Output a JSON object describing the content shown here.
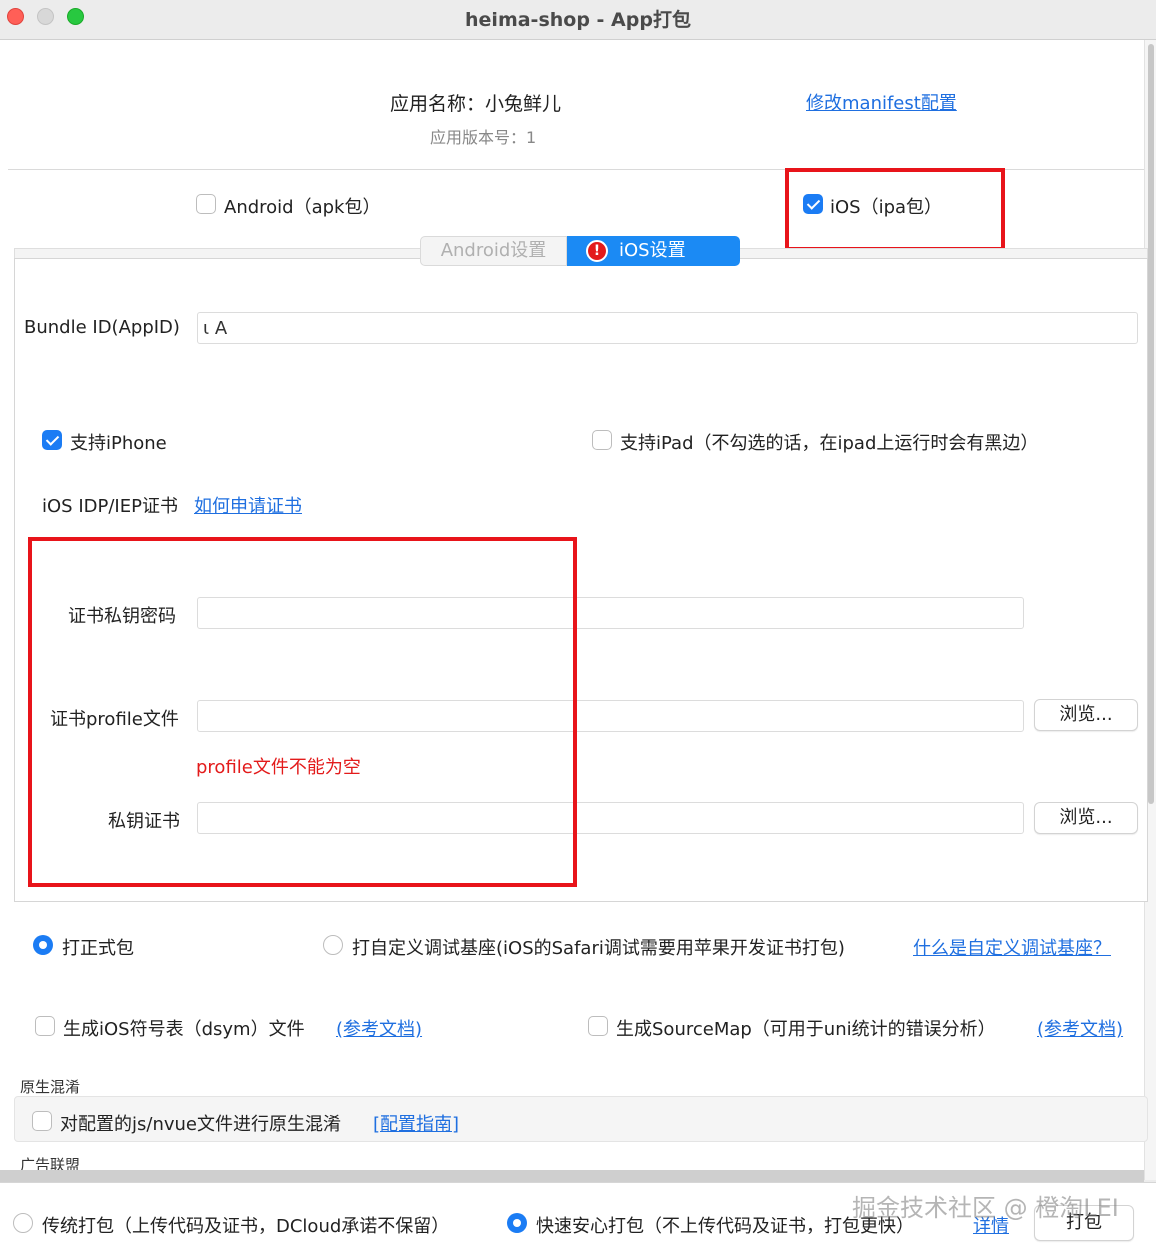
{
  "window": {
    "title": "heima-shop - App打包"
  },
  "header": {
    "app_name": "应用名称：小兔鲜儿",
    "app_version": "应用版本号：1",
    "manifest_link": "修改manifest配置"
  },
  "platforms": {
    "android": {
      "label": "Android（apk包）",
      "checked": false
    },
    "ios": {
      "label": "iOS（ipa包）",
      "checked": true
    }
  },
  "tabs": [
    {
      "label": "Android设置",
      "active": false
    },
    {
      "label": "iOS设置",
      "active": true,
      "warning": "!"
    }
  ],
  "ios_settings": {
    "bundle_id_label": "Bundle ID(AppID)",
    "bundle_id_value": "ι                    Α",
    "support_iphone": {
      "label": "支持iPhone",
      "checked": true
    },
    "support_ipad": {
      "label": "支持iPad（不勾选的话，在ipad上运行时会有黑边）",
      "checked": false
    },
    "cert_label": "iOS IDP/IEP证书",
    "cert_help_link": "如何申请证书",
    "private_key_password_label": "证书私钥密码",
    "profile_label": "证书profile文件",
    "profile_error": "profile文件不能为空",
    "private_cert_label": "私钥证书",
    "browse_label": "浏览..."
  },
  "package_type": {
    "formal": {
      "label": "打正式包",
      "checked": true
    },
    "custom_base": {
      "label": "打自定义调试基座(iOS的Safari调试需要用苹果开发证书打包)",
      "checked": false
    },
    "custom_base_help": "什么是自定义调试基座？"
  },
  "options": {
    "dsym": {
      "label": "生成iOS符号表（dsym）文件",
      "checked": false,
      "link": "(参考文档)"
    },
    "sourcemap": {
      "label": "生成SourceMap（可用于uni统计的错误分析）",
      "checked": false,
      "link": "(参考文档)"
    }
  },
  "native_obfuscation": {
    "section_title": "原生混淆",
    "label": "对配置的js/nvue文件进行原生混淆",
    "checked": false,
    "link": "[配置指南]"
  },
  "ad_section_title": "广告联盟",
  "footer": {
    "traditional": {
      "label": "传统打包（上传代码及证书，DCloud承诺不保留）",
      "checked": false
    },
    "fast": {
      "label": "快速安心打包（不上传代码及证书，打包更快）",
      "checked": true
    },
    "details_link": "详情",
    "pack_button": "打包"
  },
  "watermark": "掘金技术社区 @ 橙淘LEI",
  "colors": {
    "accent": "#1b7cf4",
    "link": "#1f6fe0",
    "error": "#e31b1b",
    "annotation": "#e8141a"
  }
}
